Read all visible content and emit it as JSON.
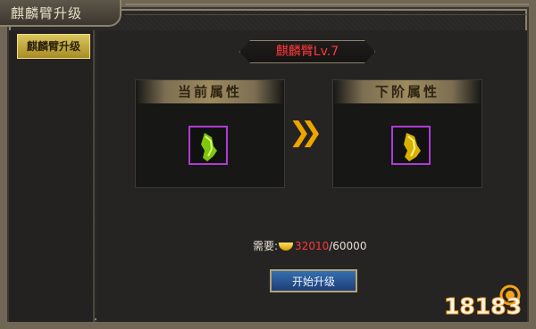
{
  "window": {
    "title": "麒麟臂升级"
  },
  "sidebar": {
    "items": [
      {
        "label": "麒麟臂升级",
        "active": true
      }
    ]
  },
  "main": {
    "level_banner": "麒麟臂Lv.7",
    "current_panel": {
      "title": "当前属性",
      "item_icon": "qilin-arm-icon"
    },
    "next_panel": {
      "title": "下阶属性",
      "item_icon": "qilin-arm-icon"
    },
    "requirement": {
      "label": "需要:",
      "current": "32010",
      "total": "/60000",
      "icon": "gold-ingot-icon"
    },
    "upgrade_button": "开始升级"
  },
  "watermark": {
    "text": "18183"
  },
  "colors": {
    "accent_red": "#ff3737",
    "item_border": "#b13bd3",
    "arrow": "#f0a400",
    "button_blue": "#1f3d76"
  }
}
